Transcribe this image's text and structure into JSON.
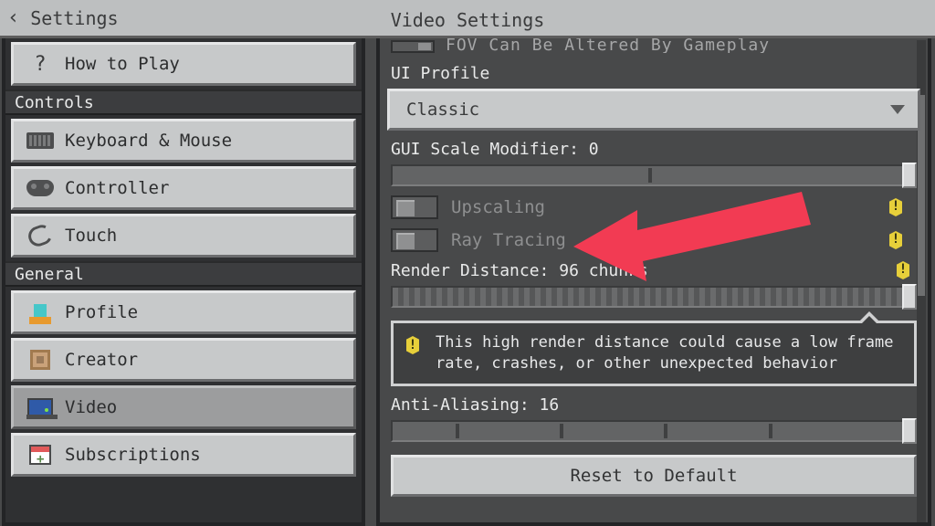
{
  "header": {
    "back_label": "Settings",
    "title": "Video Settings"
  },
  "sidebar": {
    "items": [
      {
        "label": "How to Play"
      },
      {
        "label": "Keyboard & Mouse"
      },
      {
        "label": "Controller"
      },
      {
        "label": "Touch"
      },
      {
        "label": "Profile"
      },
      {
        "label": "Creator"
      },
      {
        "label": "Video"
      },
      {
        "label": "Subscriptions"
      }
    ],
    "sections": {
      "controls": "Controls",
      "general": "General"
    }
  },
  "settings": {
    "cut_top_label": "FOV Can Be Altered By Gameplay",
    "ui_profile": {
      "label": "UI Profile",
      "value": "Classic"
    },
    "gui_scale": {
      "label": "GUI Scale Modifier: 0",
      "value": 0,
      "min": -2,
      "max": 2
    },
    "upscaling": {
      "label": "Upscaling",
      "value": false,
      "disabled": true
    },
    "ray_tracing": {
      "label": "Ray Tracing",
      "value": false,
      "disabled": true
    },
    "render_distance": {
      "label": "Render Distance: 96 chunks",
      "value": 96,
      "min": 4,
      "max": 96
    },
    "render_warning": "This high render distance could cause a low frame rate, crashes, or other unexpected behavior",
    "anti_aliasing": {
      "label": "Anti-Aliasing: 16",
      "value": 16,
      "min": 1,
      "max": 16
    },
    "reset_btn": "Reset to Default"
  },
  "colors": {
    "accent_warn": "#e7cf3a",
    "arrow": "#f23b53"
  }
}
